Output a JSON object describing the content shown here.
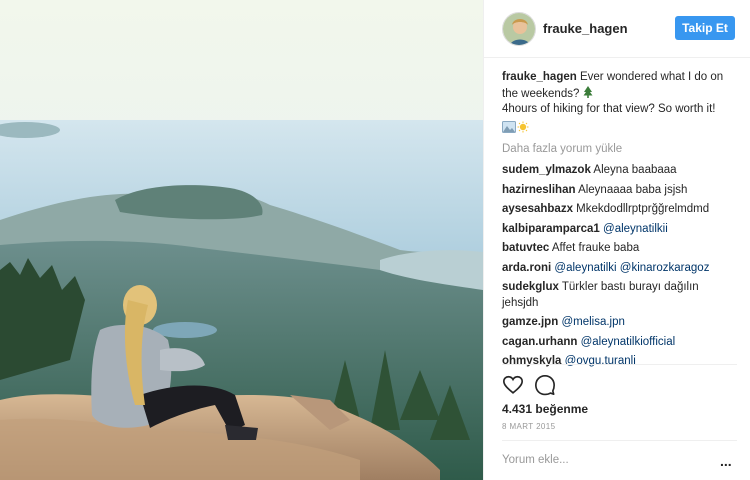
{
  "post": {
    "username": "frauke_hagen",
    "follow_label": "Takip Et",
    "caption_user": "frauke_hagen",
    "caption_line1": "Ever wondered what I do on the weekends?",
    "caption_line2": "4hours of hiking for that view? So worth it!",
    "caption_emojis": [
      "evergreen-tree",
      "sun-behind-cloud",
      "mountain-scene"
    ],
    "load_more_label": "Daha fazla yorum yükle",
    "comments": [
      {
        "user": "sudem_ylmazok",
        "text": "Aleyna baabaaa"
      },
      {
        "user": "hazirneslihan",
        "text": "Aleynaaaa baba jsjsh"
      },
      {
        "user": "aysesahbazx",
        "text": "Mkekdodllrptprğğrelmdmd"
      },
      {
        "user": "kalbiparamparca1",
        "text": "@aleynatilkii"
      },
      {
        "user": "batuvtec",
        "text": "Affet frauke baba"
      },
      {
        "user": "arda.roni",
        "text": "@aleynatilki @kinarozkaragoz"
      },
      {
        "user": "sudekglux",
        "text": "Türkler bastı burayı dağılın jehsjdh"
      },
      {
        "user": "gamze.jpn",
        "text": "@melisa.jpn"
      },
      {
        "user": "cagan.urhann",
        "text": "@aleynatilkiofficial"
      },
      {
        "user": "ohmyskyla",
        "text": "@ovgu.turanli"
      }
    ],
    "likes": "4.431 beğenme",
    "date": "8 MART 2015",
    "add_comment_placeholder": "Yorum ekle...",
    "more_options": "...",
    "icons": {
      "like": "heart-icon",
      "comment": "comment-icon",
      "more": "more-options-icon"
    },
    "colors": {
      "follow_button": "#3897f0",
      "mention": "#003569",
      "muted": "#999999"
    }
  }
}
